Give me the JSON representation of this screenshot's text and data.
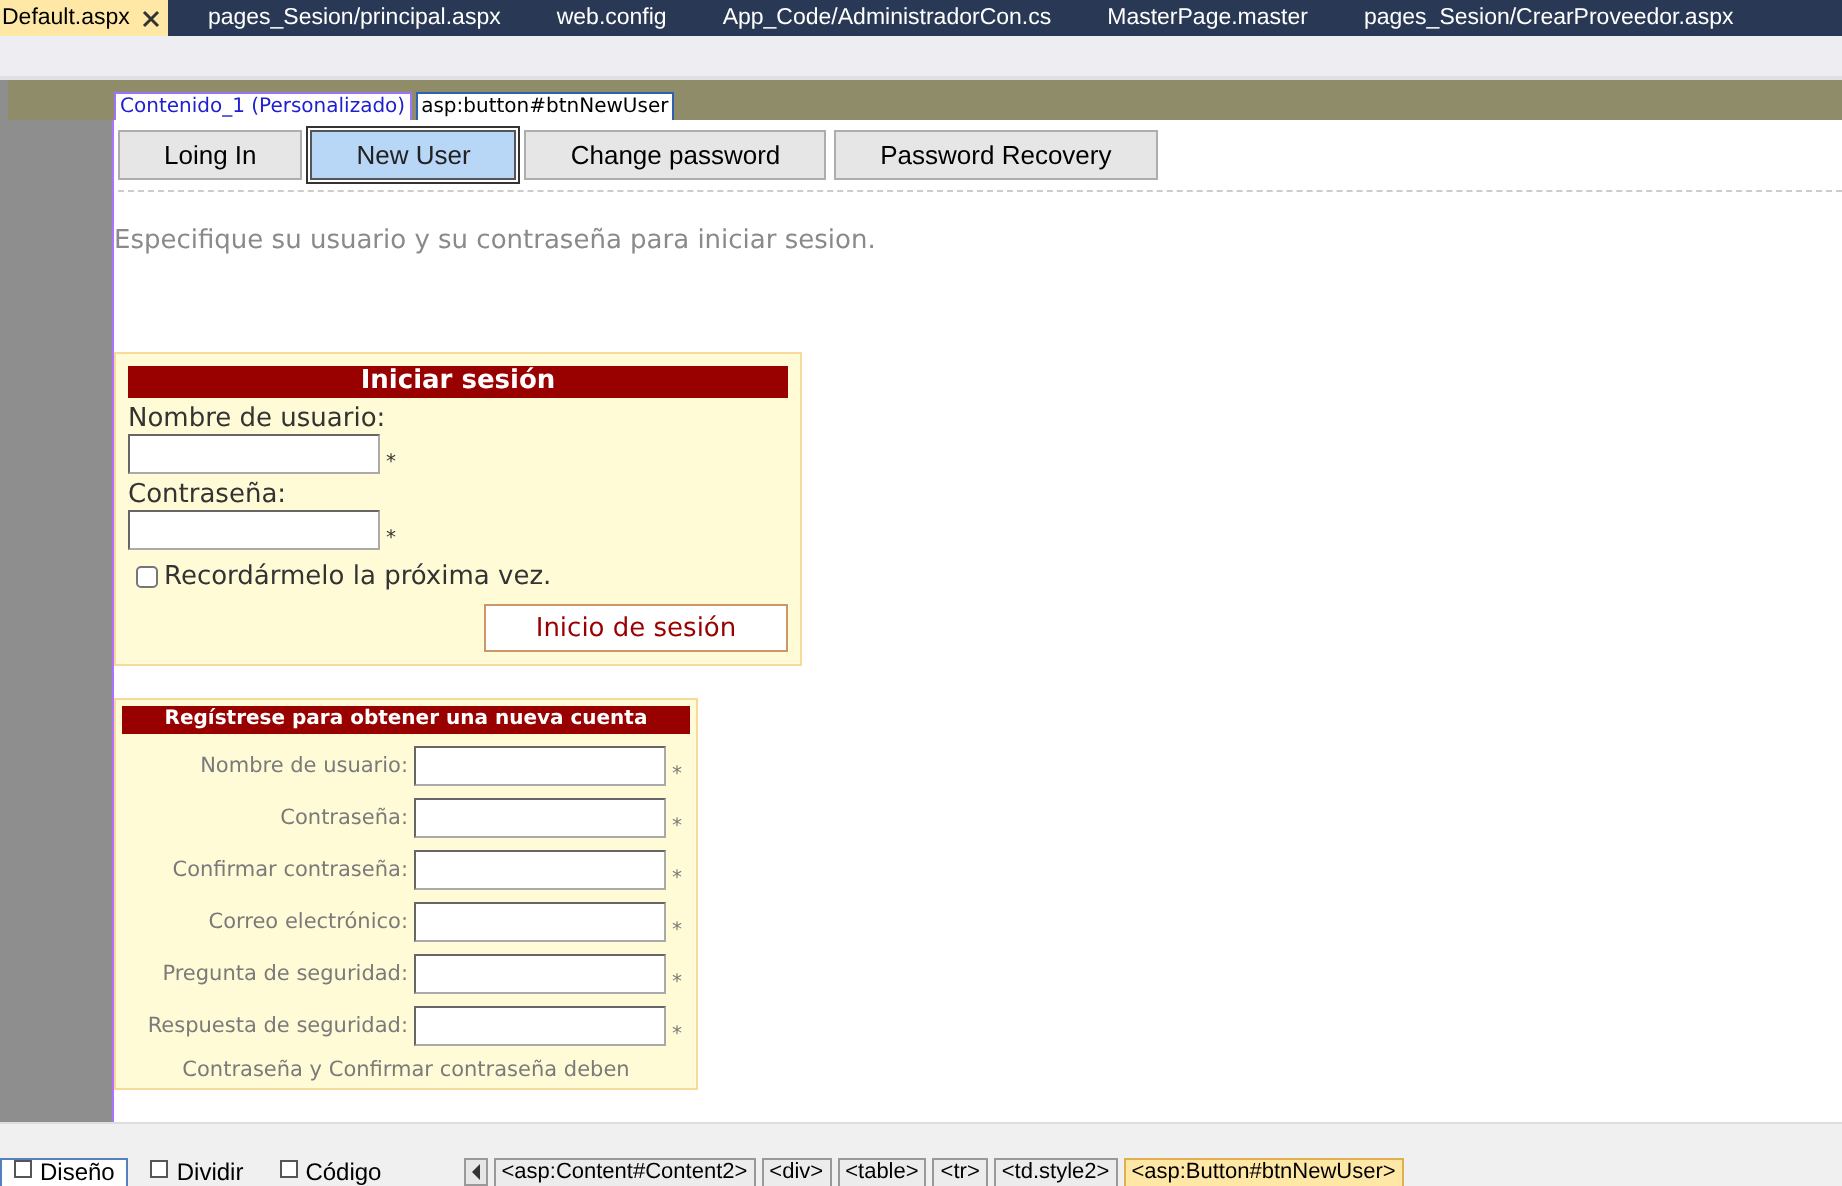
{
  "tabs": [
    {
      "label": "Default.aspx",
      "selected": true
    },
    {
      "label": "pages_Sesion/principal.aspx",
      "selected": false
    },
    {
      "label": "web.config",
      "selected": false
    },
    {
      "label": "App_Code/AdministradorCon.cs",
      "selected": false
    },
    {
      "label": "MasterPage.master",
      "selected": false
    },
    {
      "label": "pages_Sesion/CrearProveedor.aspx",
      "selected": false
    }
  ],
  "design_tags": [
    {
      "label": "Contenido_1 (Personalizado)",
      "kind": "region"
    },
    {
      "label": "asp:button#btnNewUser",
      "kind": "element"
    }
  ],
  "nav_buttons": [
    {
      "label": "Loing In",
      "selected": false
    },
    {
      "label": "New User",
      "selected": true
    },
    {
      "label": "Change password",
      "selected": false
    },
    {
      "label": "Password Recovery",
      "selected": false
    }
  ],
  "instructions": "Especifique su usuario y su contraseña para iniciar sesion.",
  "login": {
    "title": "Iniciar sesión",
    "fields": [
      {
        "label": "Nombre de usuario:",
        "required_mark": "*"
      },
      {
        "label": "Contraseña:",
        "required_mark": "*"
      }
    ],
    "remember": {
      "label": "Recordármelo la próxima vez.",
      "checked": false
    },
    "submit": "Inicio de sesión"
  },
  "register": {
    "title": "Regístrese para obtener una nueva cuenta",
    "fields": [
      {
        "label": "Nombre de usuario:",
        "required_mark": "*"
      },
      {
        "label": "Contraseña:",
        "required_mark": "*"
      },
      {
        "label": "Confirmar contraseña:",
        "required_mark": "*"
      },
      {
        "label": "Correo electrónico:",
        "required_mark": "*"
      },
      {
        "label": "Pregunta de seguridad:",
        "required_mark": "*"
      },
      {
        "label": "Respuesta de seguridad:",
        "required_mark": "*"
      }
    ],
    "note": "Contraseña y Confirmar contraseña deben"
  },
  "views": [
    {
      "label": "Diseño",
      "selected": true
    },
    {
      "label": "Dividir",
      "selected": false
    },
    {
      "label": "Código",
      "selected": false
    }
  ],
  "breadcrumb": [
    {
      "label": "<asp:Content#Content2>",
      "selected": false
    },
    {
      "label": "<div>",
      "selected": false
    },
    {
      "label": "<table>",
      "selected": false
    },
    {
      "label": "<tr>",
      "selected": false
    },
    {
      "label": "<td.style2>",
      "selected": false
    },
    {
      "label": "<asp:Button#btnNewUser>",
      "selected": true
    }
  ]
}
